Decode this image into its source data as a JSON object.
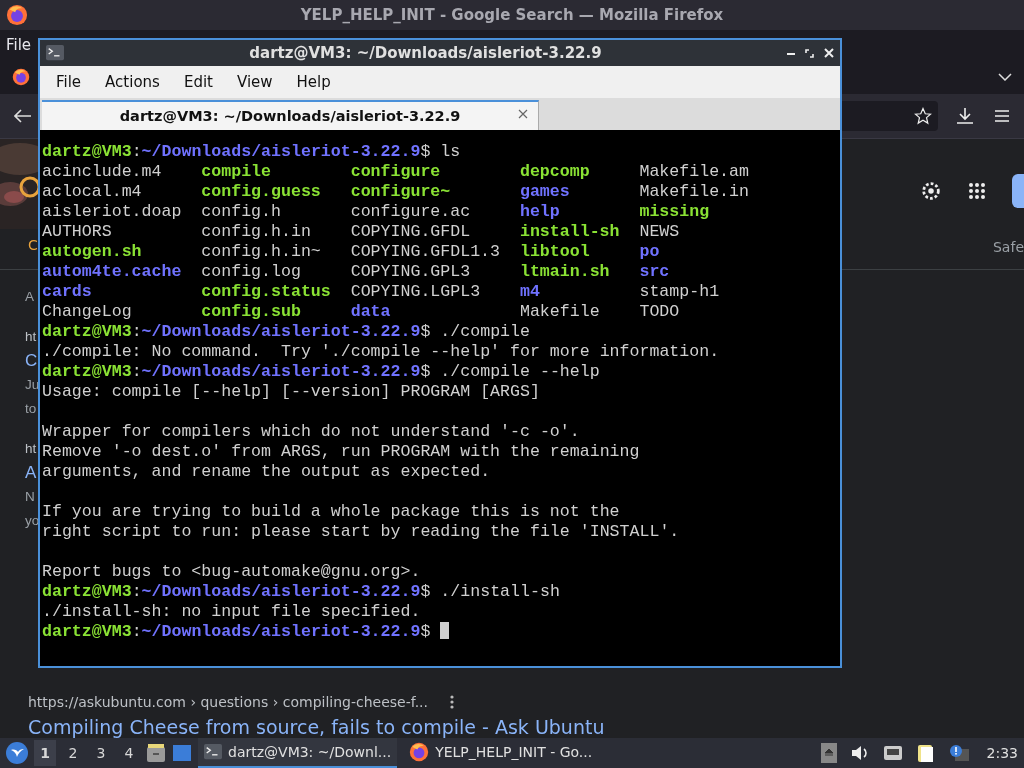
{
  "browser": {
    "title": "YELP_HELP_INIT - Google Search — Mozilla Firefox",
    "menu": [
      "File"
    ],
    "tab_fragment": "C",
    "fragments": [
      {
        "text": "A",
        "kind": "snippet"
      },
      {
        "text": "ht",
        "kind": "url"
      },
      {
        "text": "C",
        "kind": "link"
      },
      {
        "text": "Ju",
        "kind": "snippet"
      },
      {
        "text": "to",
        "kind": "snippet"
      },
      {
        "text": "ht",
        "kind": "url"
      },
      {
        "text": "A",
        "kind": "link"
      },
      {
        "text": "N",
        "kind": "snippet"
      },
      {
        "text": "yo",
        "kind": "snippet"
      }
    ],
    "safe_label": "Safe",
    "result": {
      "url": "https://askubuntu.com › questions › compiling-cheese-f...",
      "title": "Compiling Cheese from source, fails to compile - Ask Ubuntu"
    }
  },
  "terminal": {
    "title": "dartz@VM3: ~/Downloads/aisleriot-3.22.9",
    "menu": [
      "File",
      "Actions",
      "Edit",
      "View",
      "Help"
    ],
    "tabs": [
      {
        "label": "dartz@VM3: ~/Downloads/aisleriot-3.22.9",
        "selected": true
      }
    ],
    "lines": [
      {
        "kind": "prompt",
        "user": "dartz@VM3",
        "colon": ":",
        "path": "~/Downloads/aisleriot-3.22.9",
        "dollar": "$",
        "command": "ls"
      },
      {
        "kind": "ls",
        "entries": [
          {
            "name": "acinclude.m4",
            "kind": "file"
          },
          {
            "name": "compile",
            "kind": "exec"
          },
          {
            "name": "configure",
            "kind": "exec"
          },
          {
            "name": "depcomp",
            "kind": "exec"
          },
          {
            "name": "Makefile.am",
            "kind": "file"
          }
        ]
      },
      {
        "kind": "ls",
        "entries": [
          {
            "name": "aclocal.m4",
            "kind": "file"
          },
          {
            "name": "config.guess",
            "kind": "exec"
          },
          {
            "name": "configure~",
            "kind": "exec"
          },
          {
            "name": "games",
            "kind": "dir"
          },
          {
            "name": "Makefile.in",
            "kind": "file"
          }
        ]
      },
      {
        "kind": "ls",
        "entries": [
          {
            "name": "aisleriot.doap",
            "kind": "file"
          },
          {
            "name": "config.h",
            "kind": "file"
          },
          {
            "name": "configure.ac",
            "kind": "file"
          },
          {
            "name": "help",
            "kind": "dir"
          },
          {
            "name": "missing",
            "kind": "exec"
          }
        ]
      },
      {
        "kind": "ls",
        "entries": [
          {
            "name": "AUTHORS",
            "kind": "file"
          },
          {
            "name": "config.h.in",
            "kind": "file"
          },
          {
            "name": "COPYING.GFDL",
            "kind": "file"
          },
          {
            "name": "install-sh",
            "kind": "exec"
          },
          {
            "name": "NEWS",
            "kind": "file"
          }
        ]
      },
      {
        "kind": "ls",
        "entries": [
          {
            "name": "autogen.sh",
            "kind": "exec"
          },
          {
            "name": "config.h.in~",
            "kind": "file"
          },
          {
            "name": "COPYING.GFDL1.3",
            "kind": "file"
          },
          {
            "name": "libtool",
            "kind": "exec"
          },
          {
            "name": "po",
            "kind": "dir"
          }
        ]
      },
      {
        "kind": "ls",
        "entries": [
          {
            "name": "autom4te.cache",
            "kind": "dir"
          },
          {
            "name": "config.log",
            "kind": "file"
          },
          {
            "name": "COPYING.GPL3",
            "kind": "file"
          },
          {
            "name": "ltmain.sh",
            "kind": "exec"
          },
          {
            "name": "src",
            "kind": "dir"
          }
        ]
      },
      {
        "kind": "ls",
        "entries": [
          {
            "name": "cards",
            "kind": "dir"
          },
          {
            "name": "config.status",
            "kind": "exec"
          },
          {
            "name": "COPYING.LGPL3",
            "kind": "file"
          },
          {
            "name": "m4",
            "kind": "dir"
          },
          {
            "name": "stamp-h1",
            "kind": "file"
          }
        ]
      },
      {
        "kind": "ls",
        "entries": [
          {
            "name": "ChangeLog",
            "kind": "file"
          },
          {
            "name": "config.sub",
            "kind": "exec"
          },
          {
            "name": "data",
            "kind": "dir"
          },
          {
            "name": "Makefile",
            "kind": "file"
          },
          {
            "name": "TODO",
            "kind": "file"
          }
        ]
      },
      {
        "kind": "prompt",
        "user": "dartz@VM3",
        "colon": ":",
        "path": "~/Downloads/aisleriot-3.22.9",
        "dollar": "$",
        "command": "./compile"
      },
      {
        "kind": "output",
        "text": "./compile: No command.  Try './compile --help' for more information."
      },
      {
        "kind": "prompt",
        "user": "dartz@VM3",
        "colon": ":",
        "path": "~/Downloads/aisleriot-3.22.9",
        "dollar": "$",
        "command": "./compile --help"
      },
      {
        "kind": "output",
        "text": "Usage: compile [--help] [--version] PROGRAM [ARGS]"
      },
      {
        "kind": "blank"
      },
      {
        "kind": "output",
        "text": "Wrapper for compilers which do not understand '-c -o'."
      },
      {
        "kind": "output",
        "text": "Remove '-o dest.o' from ARGS, run PROGRAM with the remaining"
      },
      {
        "kind": "output",
        "text": "arguments, and rename the output as expected."
      },
      {
        "kind": "blank"
      },
      {
        "kind": "output",
        "text": "If you are trying to build a whole package this is not the"
      },
      {
        "kind": "output",
        "text": "right script to run: please start by reading the file 'INSTALL'."
      },
      {
        "kind": "blank"
      },
      {
        "kind": "output",
        "text": "Report bugs to <bug-automake@gnu.org>."
      },
      {
        "kind": "prompt",
        "user": "dartz@VM3",
        "colon": ":",
        "path": "~/Downloads/aisleriot-3.22.9",
        "dollar": "$",
        "command": "./install-sh"
      },
      {
        "kind": "output",
        "text": "./install-sh: no input file specified."
      },
      {
        "kind": "prompt",
        "user": "dartz@VM3",
        "colon": ":",
        "path": "~/Downloads/aisleriot-3.22.9",
        "dollar": "$",
        "cursor": true
      }
    ]
  },
  "taskbar": {
    "workspaces": [
      {
        "label": "1",
        "selected": true
      },
      {
        "label": "2",
        "selected": false
      },
      {
        "label": "3",
        "selected": false
      },
      {
        "label": "4",
        "selected": false
      }
    ],
    "tasks": [
      {
        "label": "dartz@VM3: ~/Downl...",
        "kind": "terminal",
        "selected": true
      },
      {
        "label": "YELP_HELP_INIT - Go...",
        "kind": "browser",
        "selected": false
      }
    ],
    "clock": "2:33"
  }
}
